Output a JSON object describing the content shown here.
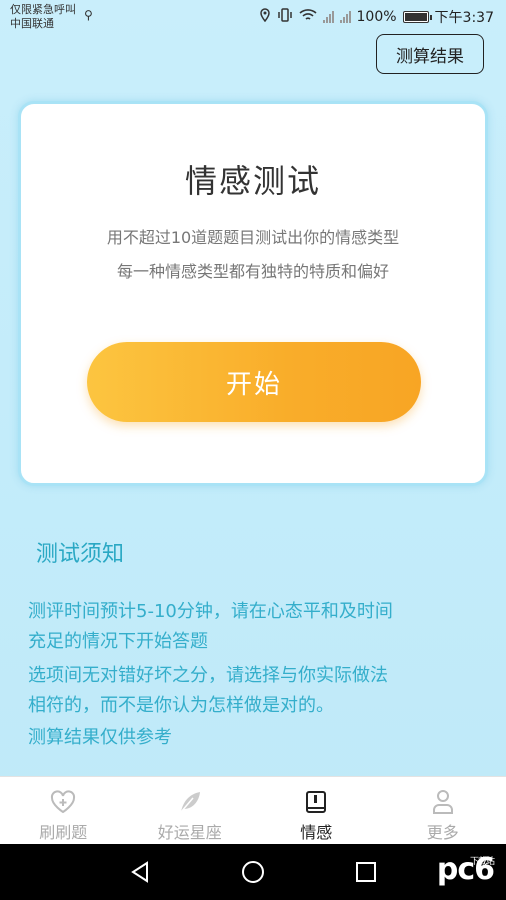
{
  "status_bar": {
    "left_line1": "仅限紧急呼叫",
    "left_line2": "中国联通",
    "battery": "100%",
    "time": "下午3:37"
  },
  "header": {
    "result_button": "测算结果"
  },
  "card": {
    "title": "情感测试",
    "desc_line1": "用不超过10道题题目测试出你的情感类型",
    "desc_line2": "每一种情感类型都有独特的特质和偏好",
    "start_button": "开始"
  },
  "notice": {
    "title": "测试须知",
    "lines": [
      "测评时间预计5-10分钟，请在心态平和及时间",
      "充足的情况下开始答题",
      "选项间无对错好坏之分，请选择与你实际做法",
      "相符的，而不是你认为怎样做是对的。",
      "测算结果仅供参考"
    ]
  },
  "bottom_nav": {
    "items": [
      {
        "label": "刷刷题",
        "icon": "heart-plus-icon",
        "active": false
      },
      {
        "label": "好运星座",
        "icon": "feather-icon",
        "active": false
      },
      {
        "label": "情感",
        "icon": "book-icon",
        "active": true
      },
      {
        "label": "更多",
        "icon": "person-icon",
        "active": false
      }
    ]
  },
  "watermark": {
    "text": "pc6",
    "sub": "下载站"
  },
  "colors": {
    "accent": "#34aecb",
    "button_orange": "#f9ad2a",
    "background": "#c6edfa"
  }
}
